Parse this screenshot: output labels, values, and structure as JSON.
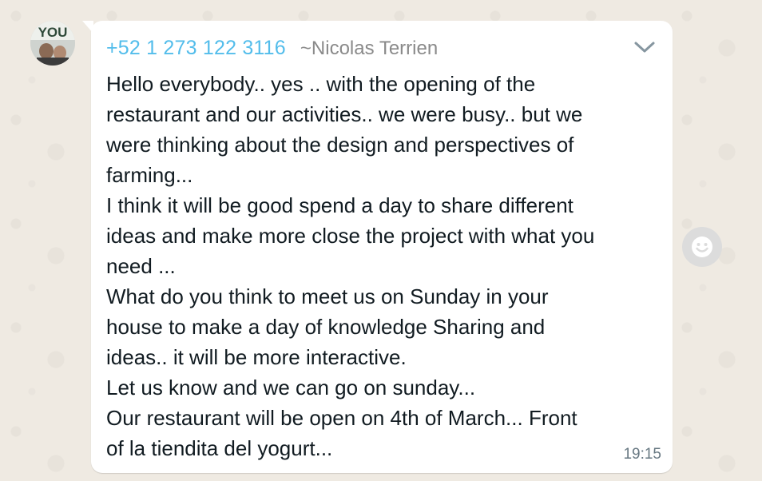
{
  "message": {
    "sender_phone": "+52 1 273 122 3116",
    "sender_name": "~Nicolas Terrien",
    "avatar_text": "YOU",
    "lines": [
      "Hello everybody.. yes .. with the opening of the",
      "restaurant and our activities.. we were busy.. but we",
      "were thinking about the design and perspectives of",
      "farming...",
      "I think it will be good spend a day to share different",
      "ideas and make more close the project with what you",
      "need ...",
      "What do you think to meet us on Sunday in your",
      "house to make a day of knowledge Sharing and",
      "ideas.. it will be more interactive.",
      "Let us know and we can go on sunday...",
      "Our restaurant will be open on 4th of March... Front",
      "of la tiendita del yogurt..."
    ],
    "time": "19:15"
  },
  "icons": {
    "menu": "chevron-down-icon",
    "reaction": "emoji-smile-icon"
  },
  "colors": {
    "background": "#efeae2",
    "bubble": "#ffffff",
    "phone": "#53bdeb",
    "name": "#8a8a8a",
    "text": "#111b21",
    "time": "#667781"
  }
}
